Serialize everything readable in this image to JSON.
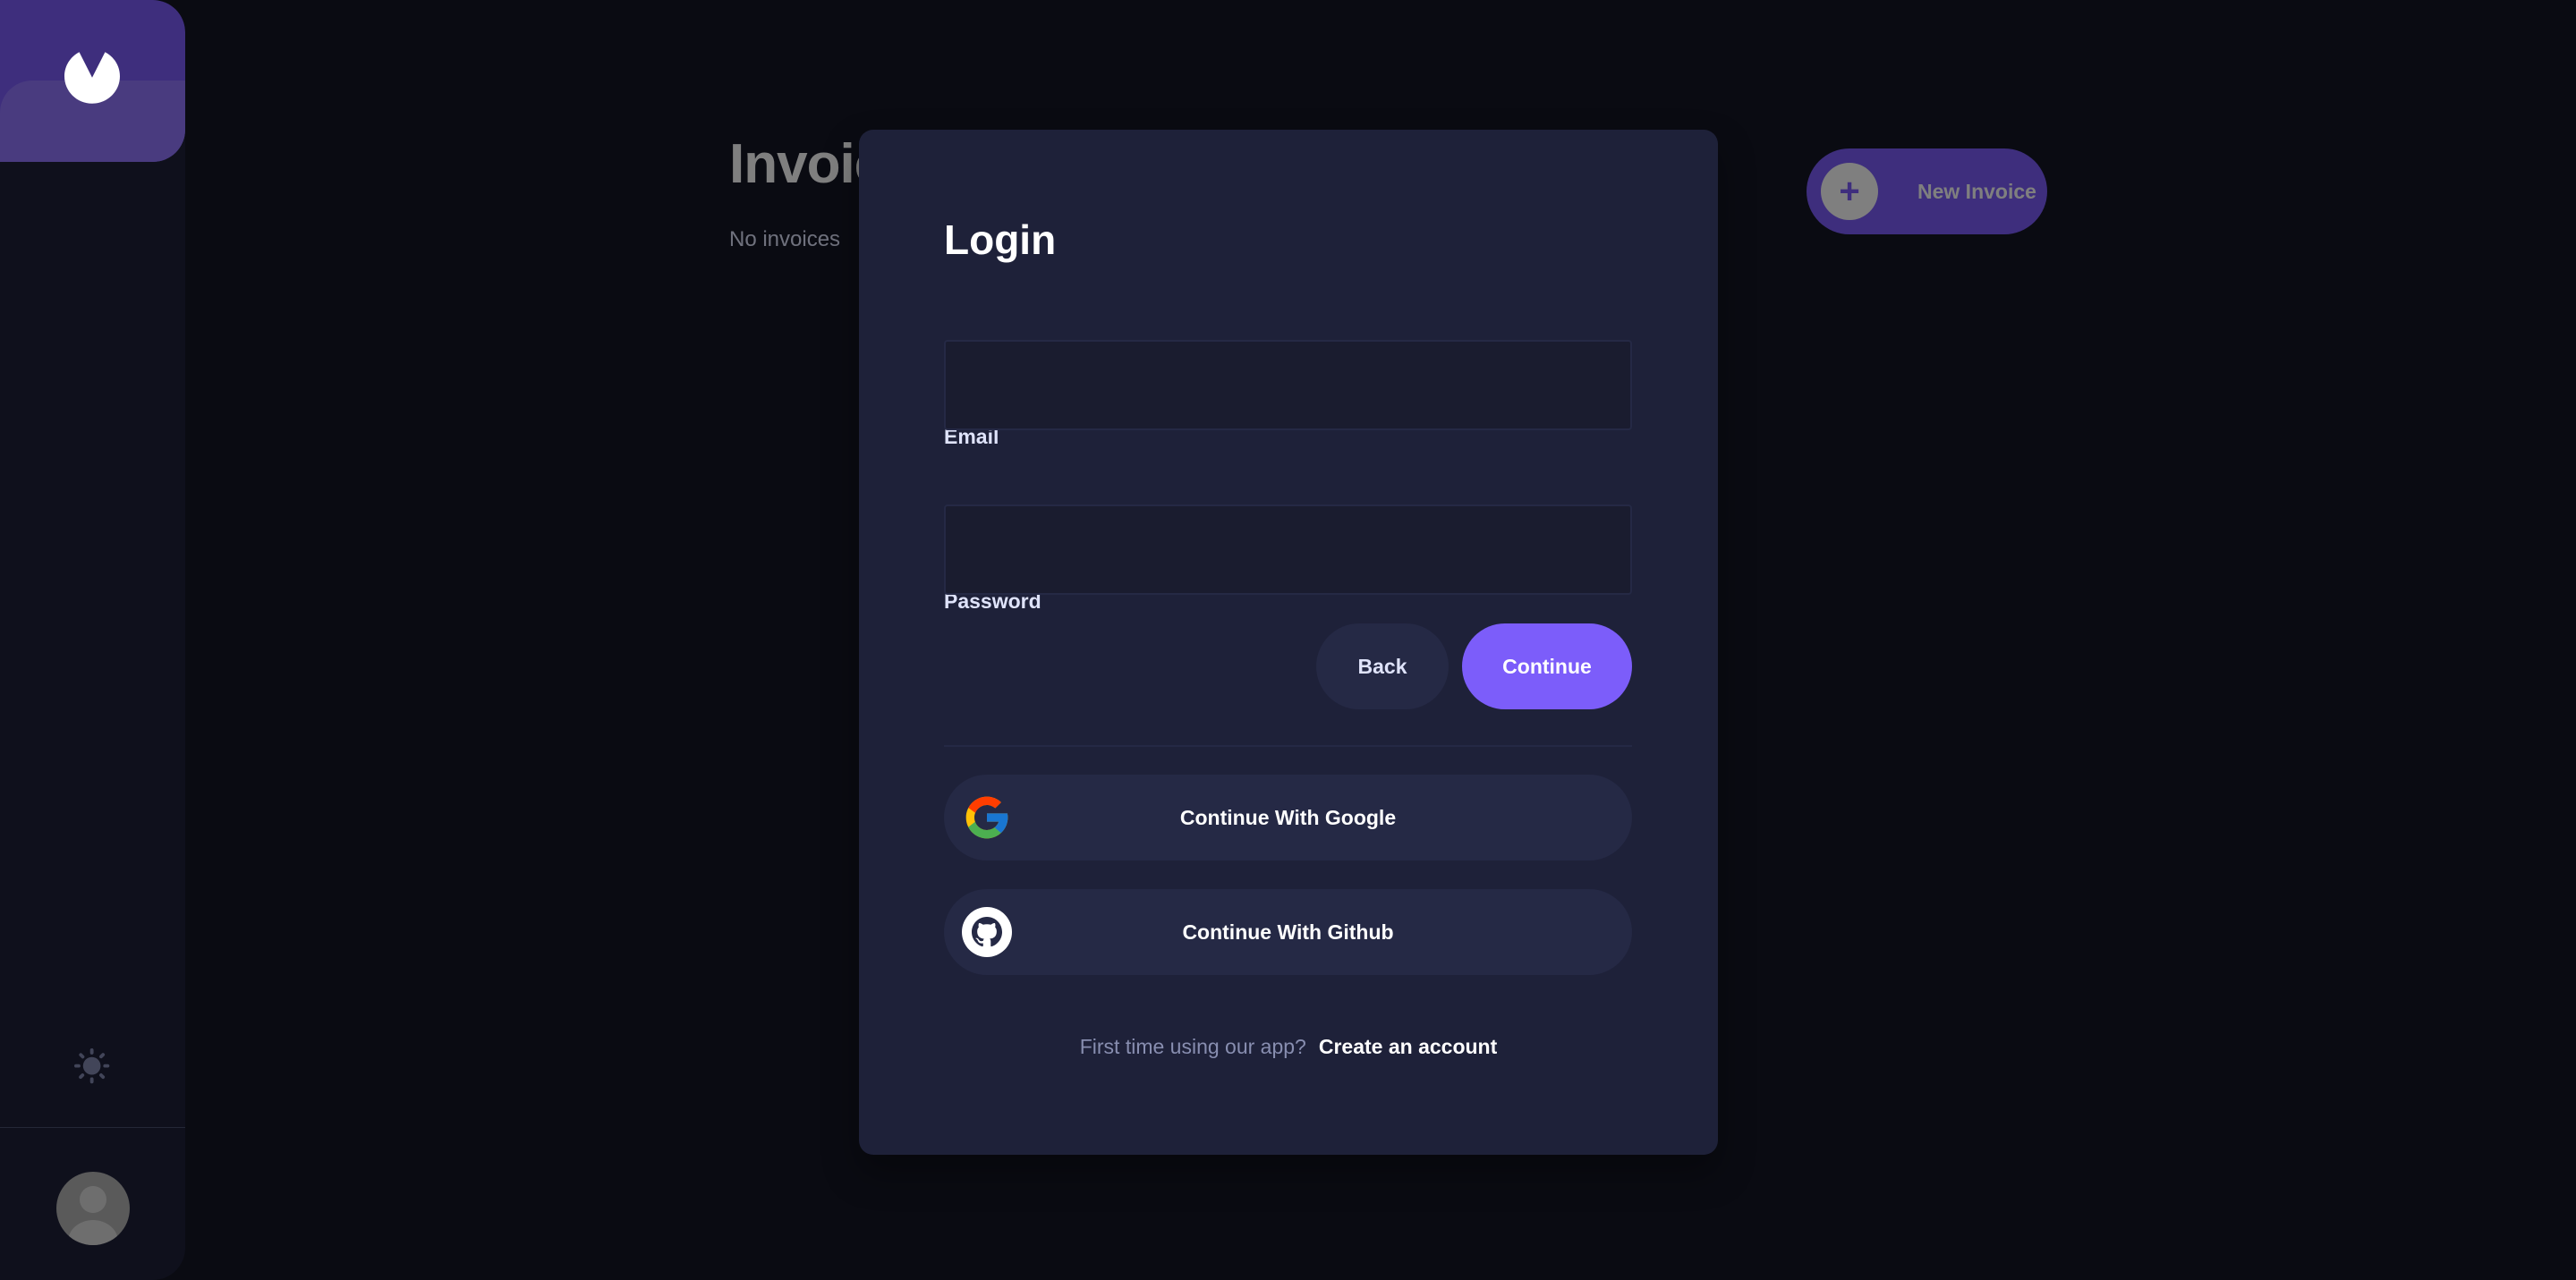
{
  "sidebar": {
    "logo_icon": "app-logo-icon",
    "theme_toggle_icon": "sun-icon",
    "avatar_icon": "user-avatar-icon"
  },
  "main": {
    "title": "Invoices",
    "subtitle": "No invoices",
    "new_invoice": {
      "label": "New Invoice",
      "icon": "plus-icon",
      "plus_glyph": "+"
    }
  },
  "login_modal": {
    "title": "Login",
    "email": {
      "label": "Email",
      "value": "",
      "placeholder": ""
    },
    "password": {
      "label": "Password",
      "value": "",
      "placeholder": ""
    },
    "back_label": "Back",
    "continue_label": "Continue",
    "google_label": "Continue With Google",
    "github_label": "Continue With Github",
    "signup_prompt": "First time using our app?",
    "signup_link": "Create an account"
  },
  "colors": {
    "accent": "#7c5dfa",
    "accent_light": "#9277ff",
    "background": "#141625",
    "surface": "#1e2139",
    "surface_alt": "#252945",
    "input_bg": "#1a1c2f",
    "muted_text": "#888eb0"
  }
}
